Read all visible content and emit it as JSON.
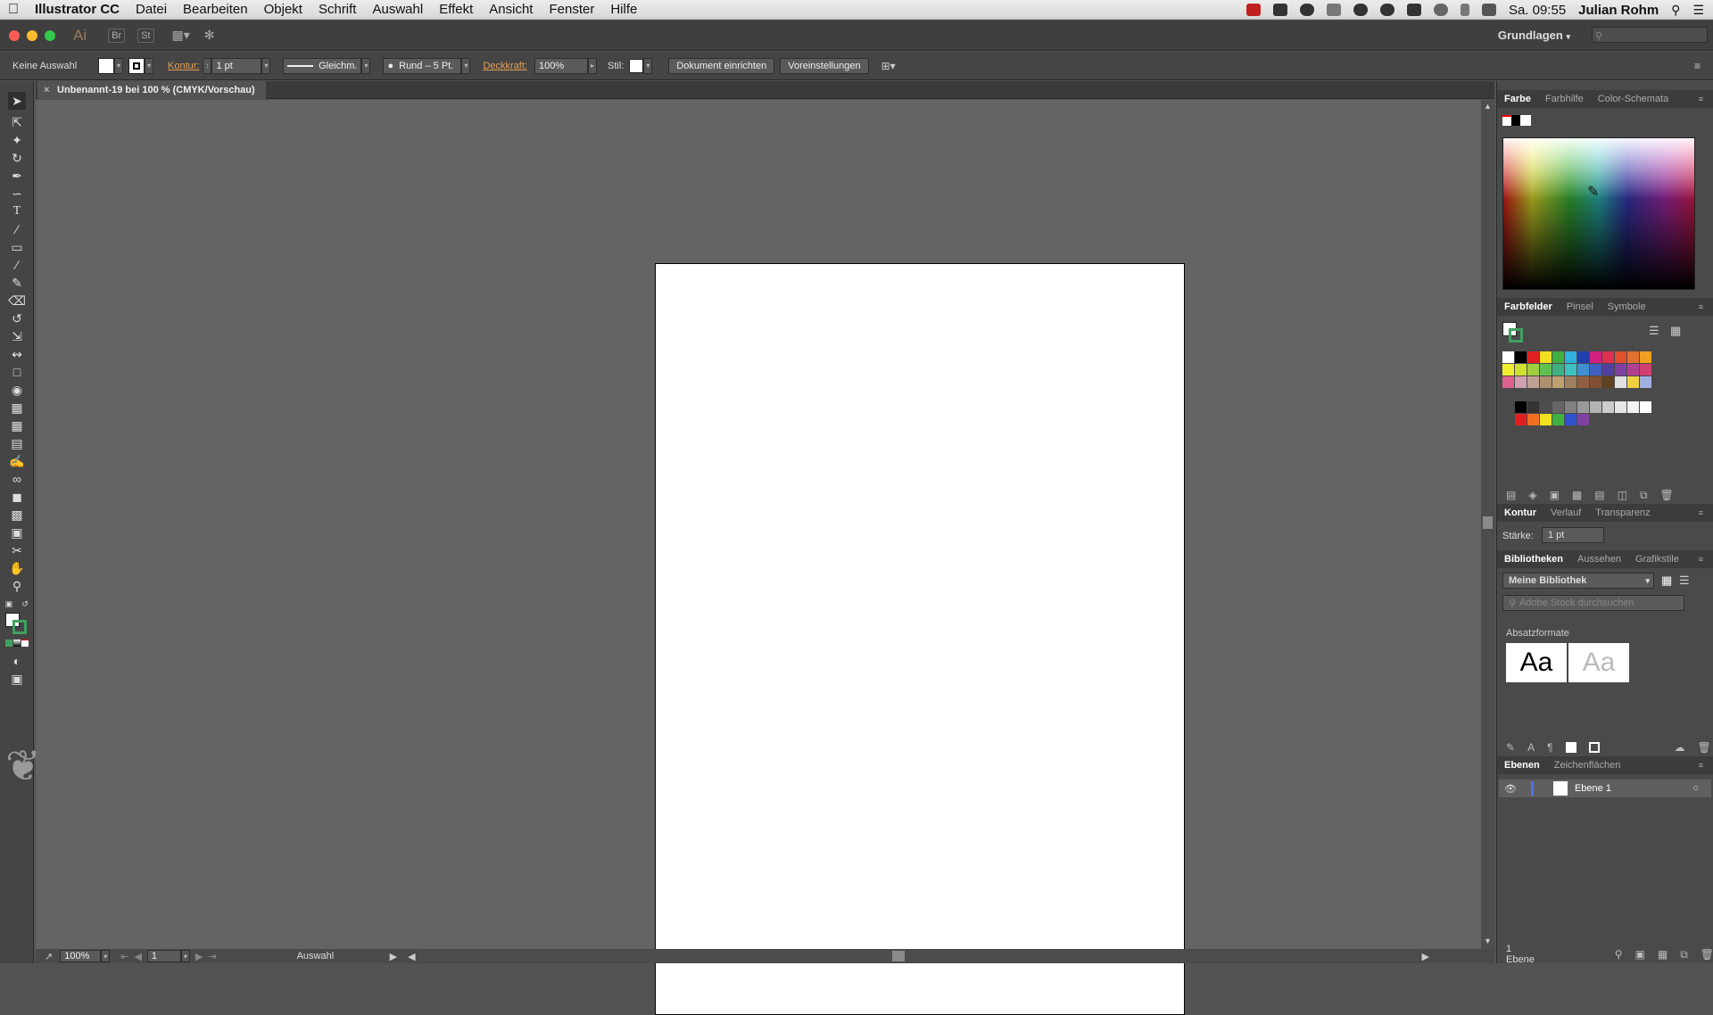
{
  "menubar": {
    "apple": "",
    "app_name": "Illustrator CC",
    "items": [
      "Datei",
      "Bearbeiten",
      "Objekt",
      "Schrift",
      "Auswahl",
      "Effekt",
      "Ansicht",
      "Fenster",
      "Hilfe"
    ],
    "clock": "Sa. 09:55",
    "user": "Julian Rohm"
  },
  "appbar": {
    "logo": "Ai",
    "br_label": "Br",
    "st_label": "St",
    "workspace": "Grundlagen"
  },
  "control_bar": {
    "selection": "Keine Auswahl",
    "stroke_label": "Kontur:",
    "stroke_value": "1 pt",
    "stroke_profile": "Gleichm.",
    "brush": "Rund – 5 Pt.",
    "opacity_label": "Deckkraft:",
    "opacity_value": "100%",
    "style_label": "Stil:",
    "doc_setup_button": "Dokument einrichten",
    "preferences_button": "Voreinstellungen"
  },
  "document": {
    "tab_title": "Unbenannt-19 bei 100 % (CMYK/Vorschau)",
    "close_glyph": "×"
  },
  "status_bar": {
    "zoom": "100%",
    "artboard_number": "1",
    "tool_status": "Auswahl"
  },
  "panels": {
    "color_tabs": [
      "Farbe",
      "Farbhilfe",
      "Color-Schemata"
    ],
    "swatch_tabs": [
      "Farbfelder",
      "Pinsel",
      "Symbole"
    ],
    "stroke_tabs": [
      "Kontur",
      "Verlauf",
      "Transparenz"
    ],
    "stroke_weight_label": "Stärke:",
    "stroke_weight_value": "1 pt",
    "library_tabs": [
      "Bibliotheken",
      "Aussehen",
      "Grafikstile"
    ],
    "library_name": "Meine Bibliothek",
    "library_search_placeholder": "Adobe Stock durchsuchen",
    "paragraph_styles_label": "Absatzformate",
    "style_sample_1": "Aa",
    "style_sample_2": "Aa",
    "layers_tabs": [
      "Ebenen",
      "Zeichenflächen"
    ],
    "layer_name": "Ebene 1",
    "layers_count": "1 Ebene"
  },
  "colors": {
    "accent_orange": "#e5a052",
    "panel_bg": "#4a4a4a",
    "canvas_bg": "#646464"
  },
  "swatches": {
    "row1": [
      "#ffffff",
      "#000000",
      "#e02020",
      "#f0e020",
      "#40b040",
      "#30b0e0",
      "#2040b0",
      "#d02080",
      "#e03050",
      "#e05030",
      "#e07030",
      "#f0a020"
    ],
    "row2": [
      "#f0f030",
      "#d0e030",
      "#a0d040",
      "#60c050",
      "#40b080",
      "#40c0c0",
      "#4090d0",
      "#4060c0",
      "#5040a0",
      "#8040a0",
      "#b04090",
      "#d04070"
    ],
    "row3": [
      "#e06090",
      "#d0a0b0",
      "#c0a090",
      "#b09070",
      "#c0a070",
      "#a08060",
      "#906040",
      "#805030",
      "#604020",
      "#e0e0e0",
      "#f0d040",
      "#a0b0e0"
    ],
    "row5": [
      "#000000",
      "#333333",
      "#4d4d4d",
      "#666666",
      "#808080",
      "#999999",
      "#b3b3b3",
      "#cccccc",
      "#e6e6e6",
      "#f2f2f2",
      "#ffffff"
    ],
    "row6": [
      "#e02020",
      "#f07020",
      "#f0e020",
      "#40b040",
      "#3050d0",
      "#8040a0"
    ]
  }
}
